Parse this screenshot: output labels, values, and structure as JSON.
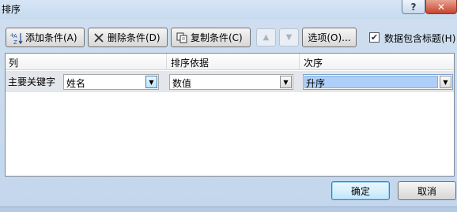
{
  "window": {
    "title": "排序",
    "help": "?",
    "close": "✕"
  },
  "toolbar": {
    "add_label": "添加条件(A)",
    "delete_label": "删除条件(D)",
    "copy_label": "复制条件(C)",
    "move_up": "▲",
    "move_down": "▼",
    "options_label": "选项(O)...",
    "header_checkbox_label": "数据包含标题(H)",
    "header_checkbox_checked": true
  },
  "grid": {
    "columns": [
      "列",
      "排序依据",
      "次序"
    ],
    "rows": [
      {
        "label": "主要关键字",
        "column": "姓名",
        "sort_on": "数值",
        "order": "升序"
      }
    ]
  },
  "buttons": {
    "ok": "确定",
    "cancel": "取消"
  },
  "icons": {
    "dropdown": "▼",
    "check": "✔"
  }
}
